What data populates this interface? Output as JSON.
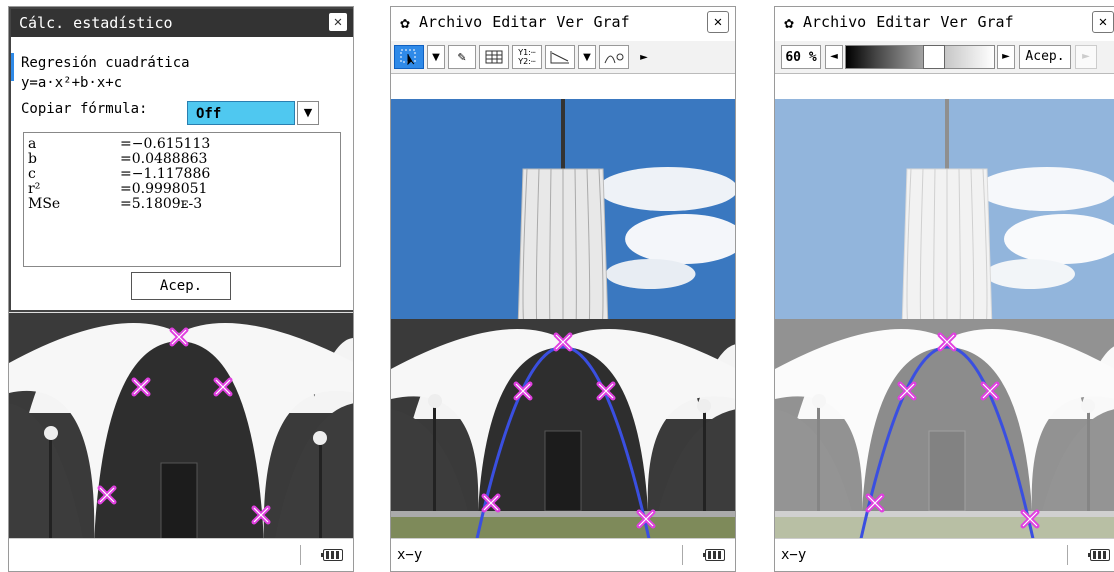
{
  "screen1": {
    "dialog": {
      "title": "Cálc. estadístico",
      "close_glyph": "✕",
      "regression_type": "Regresión cuadrática",
      "formula": "y=a·x²+b·x+c",
      "copy_formula_label": "Copiar fórmula:",
      "copy_formula_value": "Off",
      "results": [
        {
          "key": "a",
          "value": "=−0.615113"
        },
        {
          "key": "b",
          "value": "=0.0488863"
        },
        {
          "key": "c",
          "value": "=−1.117886"
        },
        {
          "key": "r²",
          "value": "=0.9998051"
        },
        {
          "key": "MSe",
          "value": "=5.1809ᴇ-3"
        }
      ],
      "ok_label": "Acep."
    }
  },
  "menubar": {
    "gear_icon": "gear-icon",
    "items": [
      "Archivo",
      "Editar",
      "Ver",
      "Graf"
    ],
    "close_glyph": "✕"
  },
  "toolbar": {
    "icons": [
      "select-icon",
      "pencil-icon",
      "table-icon",
      "graph-list-icon",
      "regression-icon",
      "curve-icon"
    ],
    "list_label": "Y1:\nY2:"
  },
  "screen3": {
    "opacity_percent": "60 %",
    "opacity_level": 0.6,
    "ok_label": "Acep."
  },
  "status": {
    "screen2_text": "x−y",
    "screen3_text": "x−y",
    "battery_icon": "battery-icon"
  },
  "colors": {
    "marker": "#e040e0",
    "curve": "#3a4fe0",
    "selection_blue": "#2f8ae8",
    "dropdown": "#4fc8f0"
  }
}
